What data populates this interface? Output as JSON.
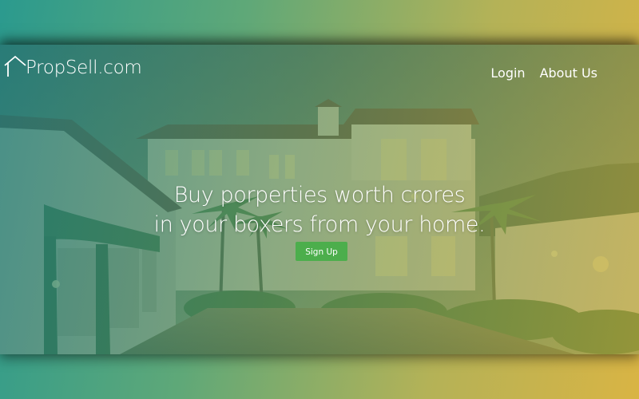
{
  "header": {
    "logo_text": "PropSell.com",
    "nav": [
      {
        "label": "Login"
      },
      {
        "label": "About Us"
      }
    ]
  },
  "hero": {
    "title_line1": "Buy porperties worth crores",
    "title_line2": "in your boxers from your home.",
    "cta_label": "Sign Up"
  },
  "colors": {
    "cta_background": "#4cae4c",
    "tint_left": "#1c8282",
    "tint_right": "#c8af3c"
  },
  "icons": {
    "logo": "house-outline-icon"
  }
}
